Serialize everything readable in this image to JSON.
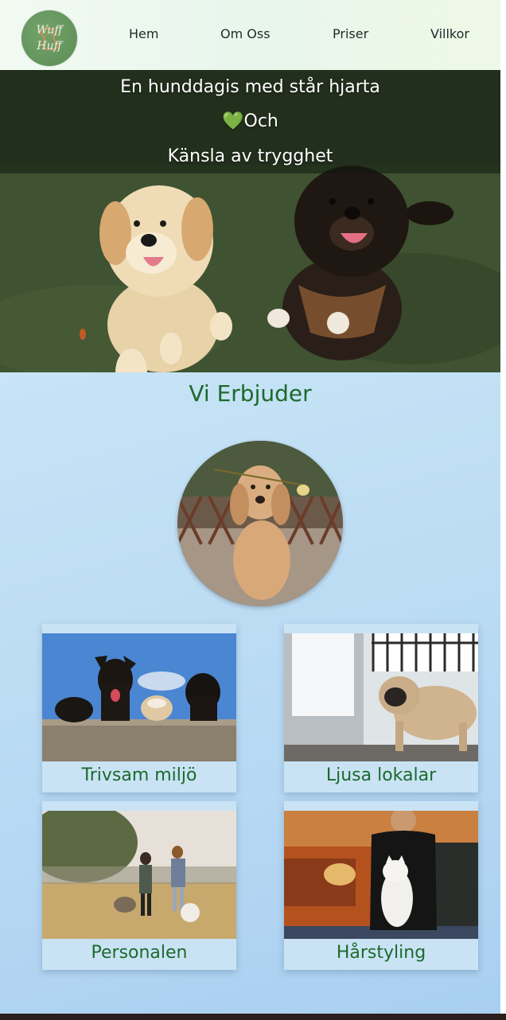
{
  "header": {
    "logo_text_top": "Wuff",
    "logo_text_bottom": "Huff",
    "nav": [
      "Hem",
      "Om Oss",
      "Priser",
      "Villkor"
    ]
  },
  "hero": {
    "line1": "En hunddagis med står hjarta",
    "line2_icon": "green-heart-icon",
    "line2": "Och",
    "line3": "Känsla av trygghet"
  },
  "offers": {
    "title": "Vi Erbjuder",
    "cards": [
      {
        "label": "Trivsam miljö"
      },
      {
        "label": "Ljusa lokalar"
      },
      {
        "label": "Personalen"
      },
      {
        "label": "Hårstyling"
      }
    ]
  },
  "colors": {
    "accent_green": "#1d6a2b",
    "heart_green": "#6fd24a",
    "page_bg": "#c4e2f5"
  }
}
